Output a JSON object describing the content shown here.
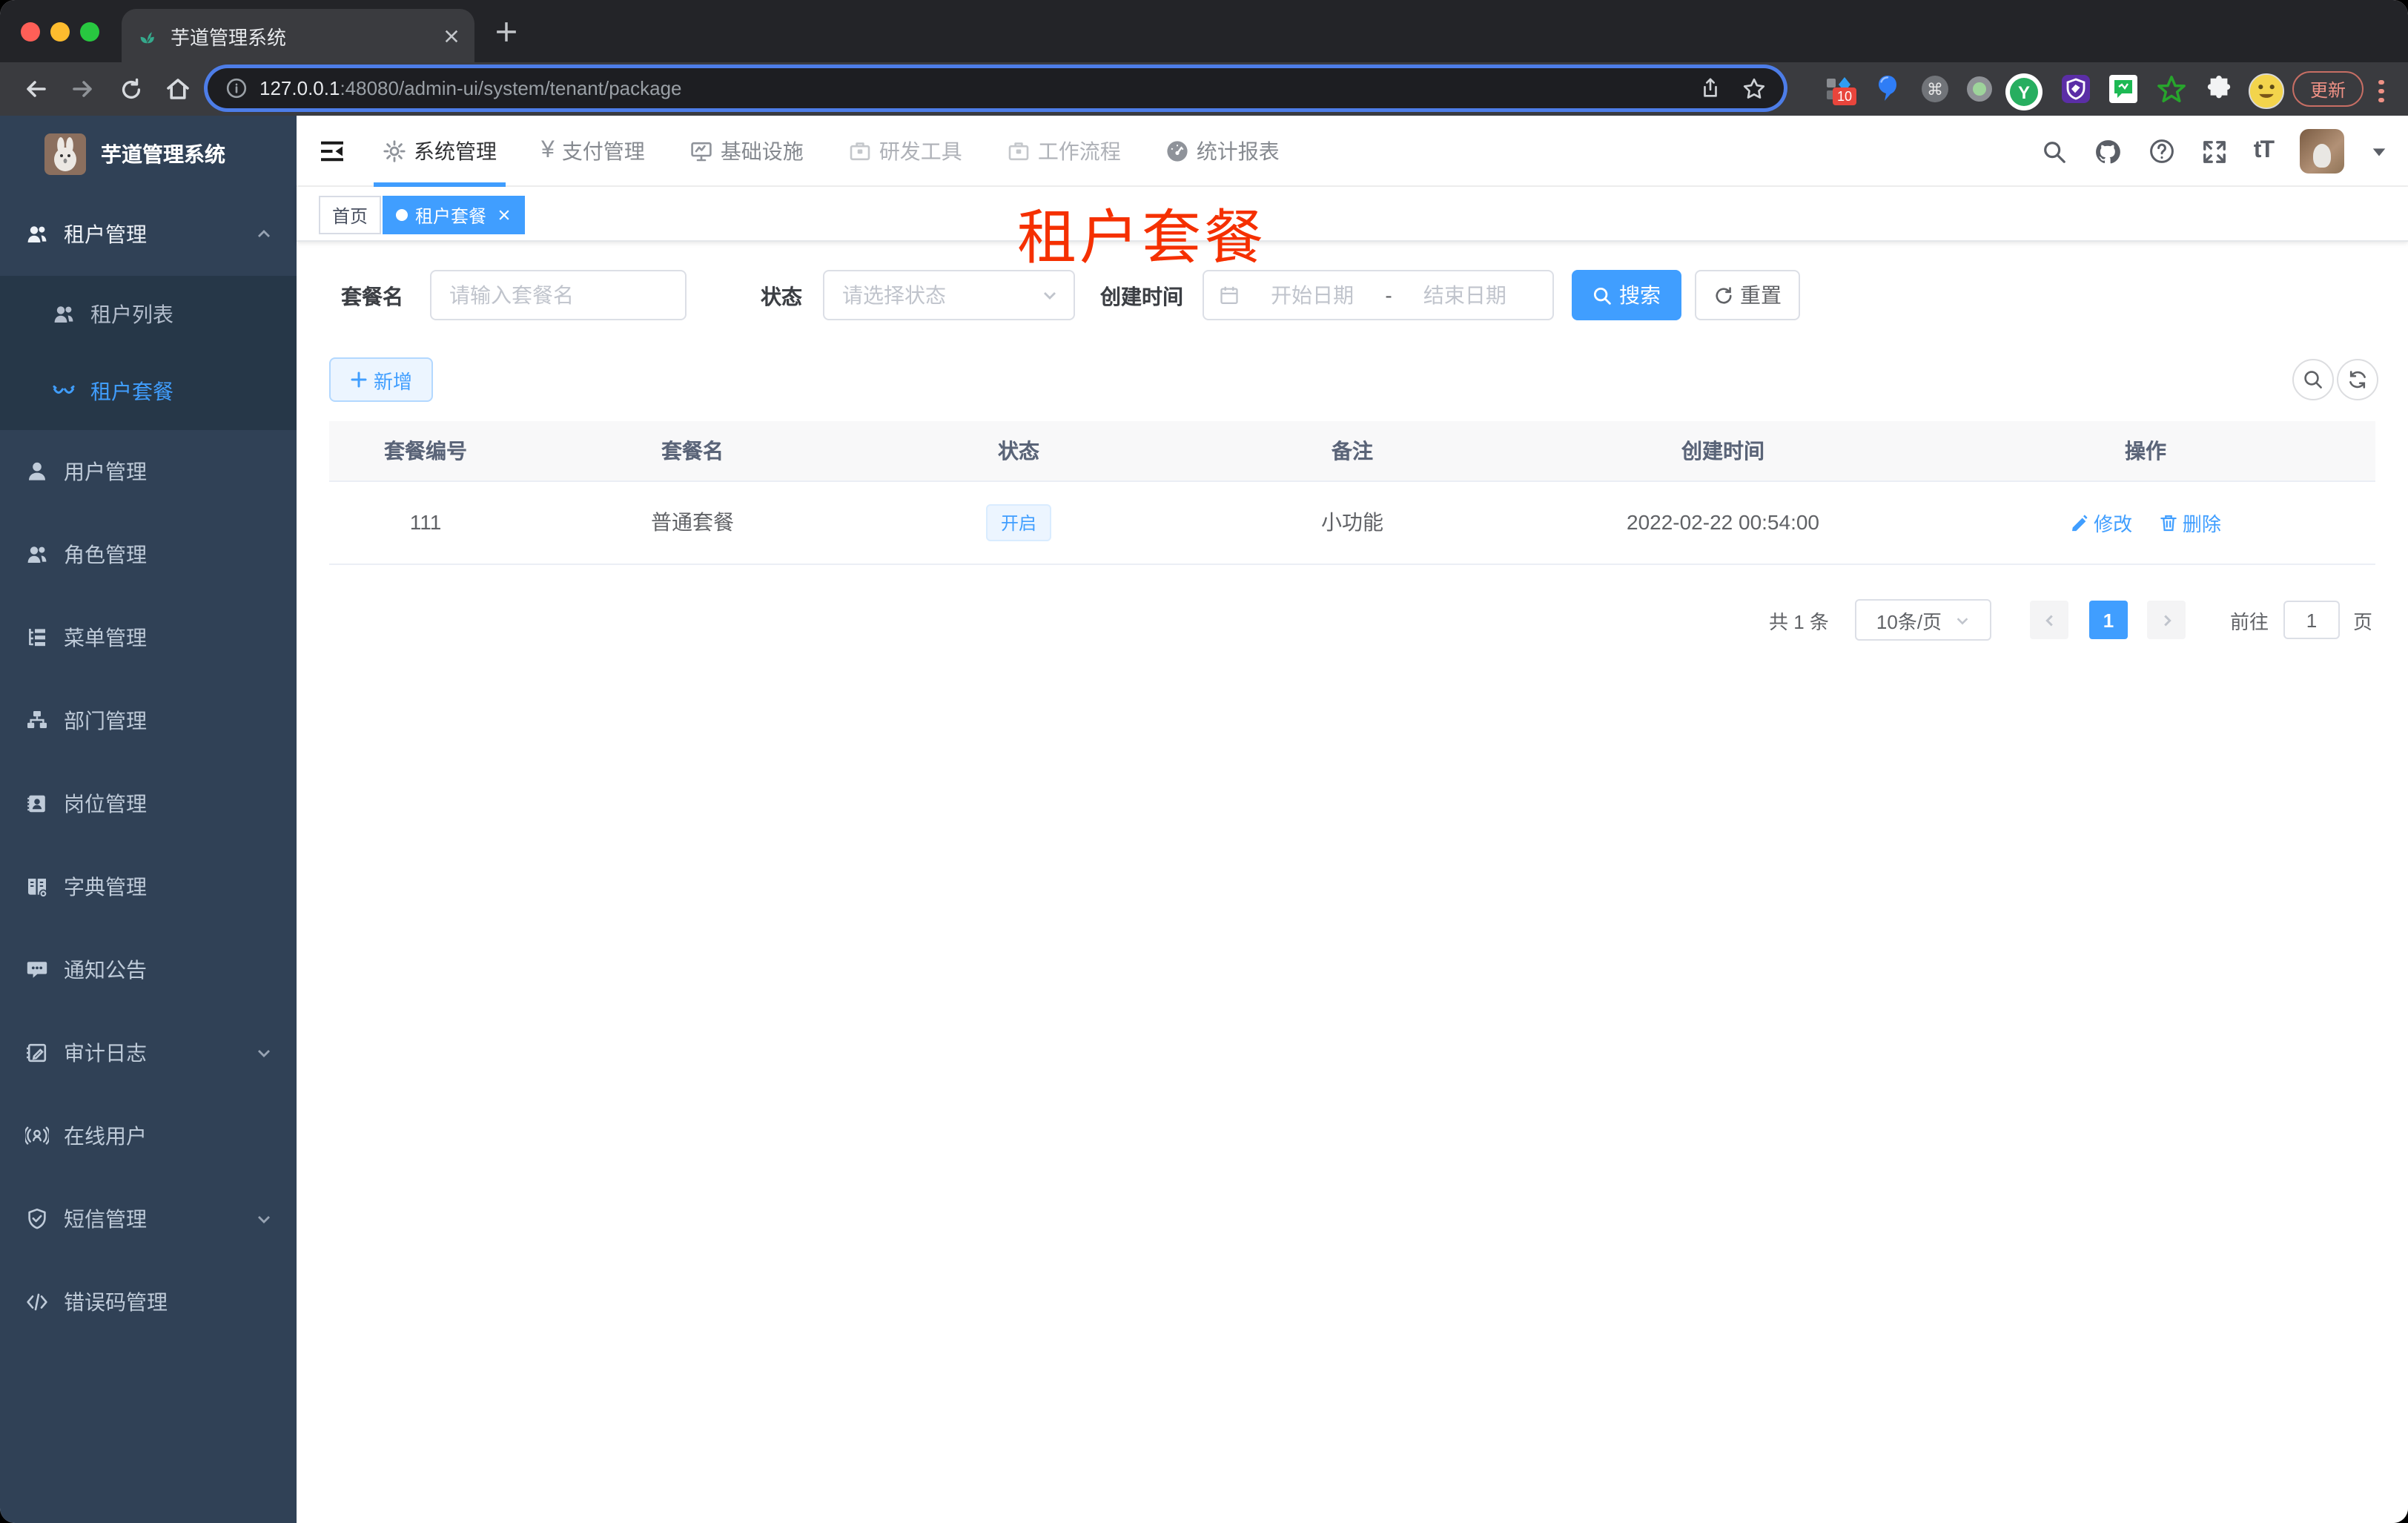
{
  "browser": {
    "tab_title": "芋道管理系统",
    "url_host": "127.0.0.1",
    "url_path": ":48080/admin-ui/system/tenant/package",
    "update_label": "更新",
    "ext_badge": "10",
    "ext_y_label": "Y"
  },
  "sidebar": {
    "app_title": "芋道管理系统",
    "items": [
      {
        "label": "租户管理"
      },
      {
        "label": "租户列表"
      },
      {
        "label": "租户套餐"
      },
      {
        "label": "用户管理"
      },
      {
        "label": "角色管理"
      },
      {
        "label": "菜单管理"
      },
      {
        "label": "部门管理"
      },
      {
        "label": "岗位管理"
      },
      {
        "label": "字典管理"
      },
      {
        "label": "通知公告"
      },
      {
        "label": "审计日志"
      },
      {
        "label": "在线用户"
      },
      {
        "label": "短信管理"
      },
      {
        "label": "错误码管理"
      }
    ]
  },
  "navbar": {
    "menus": [
      {
        "label": "系统管理"
      },
      {
        "label": "支付管理"
      },
      {
        "label": "基础设施"
      },
      {
        "label": "研发工具"
      },
      {
        "label": "工作流程"
      },
      {
        "label": "统计报表"
      }
    ],
    "yen": "¥",
    "font_label": "tT"
  },
  "tags": {
    "home": "首页",
    "active": "租户套餐"
  },
  "annotation": {
    "text": "租户套餐"
  },
  "filters": {
    "name_label": "套餐名",
    "name_placeholder": "请输入套餐名",
    "status_label": "状态",
    "status_placeholder": "请选择状态",
    "time_label": "创建时间",
    "start_placeholder": "开始日期",
    "separator": "-",
    "end_placeholder": "结束日期",
    "search_label": "搜索",
    "reset_label": "重置"
  },
  "toolbar": {
    "add_label": "新增"
  },
  "table": {
    "columns": [
      "套餐编号",
      "套餐名",
      "状态",
      "备注",
      "创建时间",
      "操作"
    ],
    "rows": [
      {
        "id": "111",
        "name": "普通套餐",
        "status": "开启",
        "remark": "小功能",
        "created": "2022-02-22 00:54:00",
        "edit": "修改",
        "delete": "删除"
      }
    ]
  },
  "pagination": {
    "total": "共 1 条",
    "page_size": "10条/页",
    "page": "1",
    "goto": "前往",
    "goto_value": "1",
    "unit": "页"
  }
}
